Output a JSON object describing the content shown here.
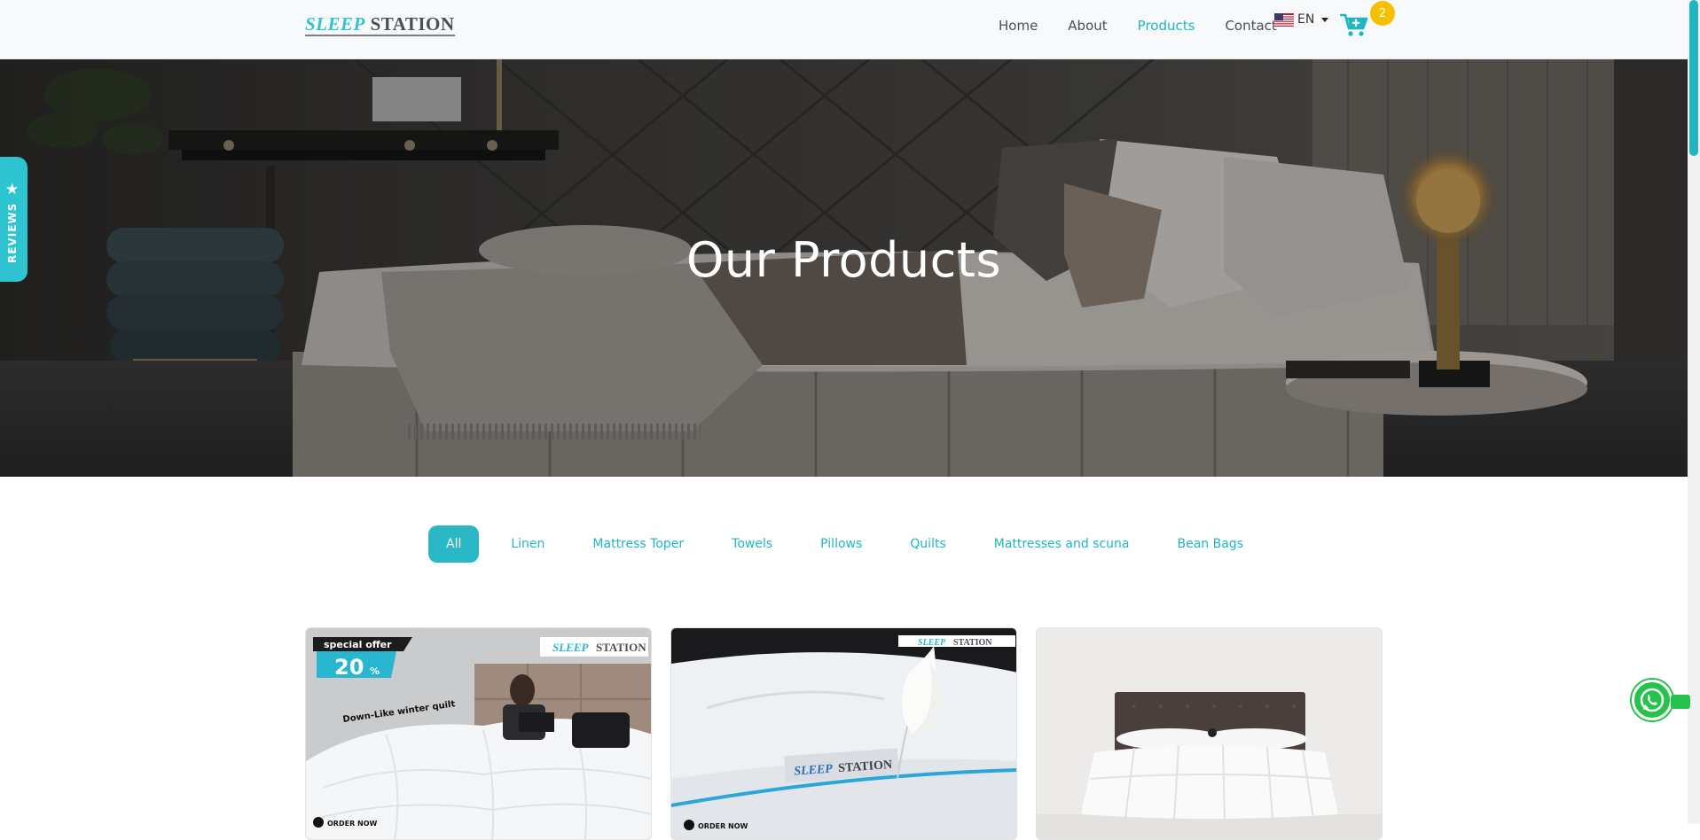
{
  "header": {
    "logo_part1": "SLEEP",
    "logo_part2": "STATION",
    "nav": [
      {
        "label": "Home"
      },
      {
        "label": "About"
      },
      {
        "label": "Products"
      },
      {
        "label": "Contact"
      }
    ],
    "active_nav": "Products",
    "language": "EN",
    "cart_count": "2"
  },
  "reviews_tab": {
    "label": "REVIEWS"
  },
  "hero": {
    "title": "Our Products"
  },
  "filters": [
    {
      "label": "All"
    },
    {
      "label": "Linen"
    },
    {
      "label": "Mattress Toper"
    },
    {
      "label": "Towels"
    },
    {
      "label": "Pillows"
    },
    {
      "label": "Quilts"
    },
    {
      "label": "Mattresses and scuna"
    },
    {
      "label": "Bean Bags"
    }
  ],
  "active_filter": "All",
  "products": [
    {
      "offer_label": "special offer",
      "offer_value": "20",
      "offer_unit": "%",
      "brand_part1": "SLEEP",
      "brand_part2": "STATION",
      "caption": "Down-Like winter quilt",
      "cta": "ORDER NOW"
    },
    {
      "brand_part1": "SLEEP",
      "brand_part2": "STATION",
      "tag_part1": "SLEEP",
      "tag_part2": "STATION",
      "cta": "ORDER NOW"
    },
    {}
  ],
  "colors": {
    "accent": "#1fb6c4",
    "badge": "#f6c000",
    "whatsapp": "#27c24c"
  },
  "icons": [
    "us-flag-icon",
    "cart-icon",
    "star-icon",
    "whatsapp-icon"
  ]
}
